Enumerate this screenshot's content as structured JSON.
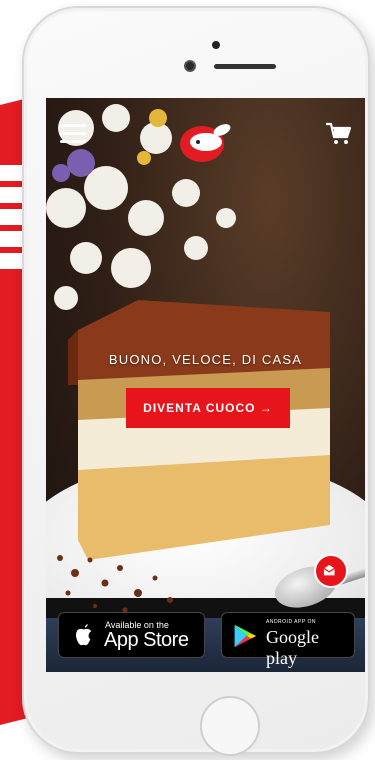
{
  "hero": {
    "tagline": "BUONO, VELOCE, DI CASA",
    "cta_label": "DIVENTA CUOCO →"
  },
  "header": {
    "menu_icon": "hamburger-menu-icon",
    "logo_icon": "bunny-logo-icon",
    "cart_icon": "shopping-cart-icon"
  },
  "chat": {
    "icon": "envelope-icon"
  },
  "stores": {
    "apple_small": "Available on the",
    "apple_big": "App Store",
    "google_small": "ANDROID APP ON",
    "google_big": "Google play"
  },
  "colors": {
    "brand_red": "#e8141b",
    "white": "#ffffff"
  }
}
